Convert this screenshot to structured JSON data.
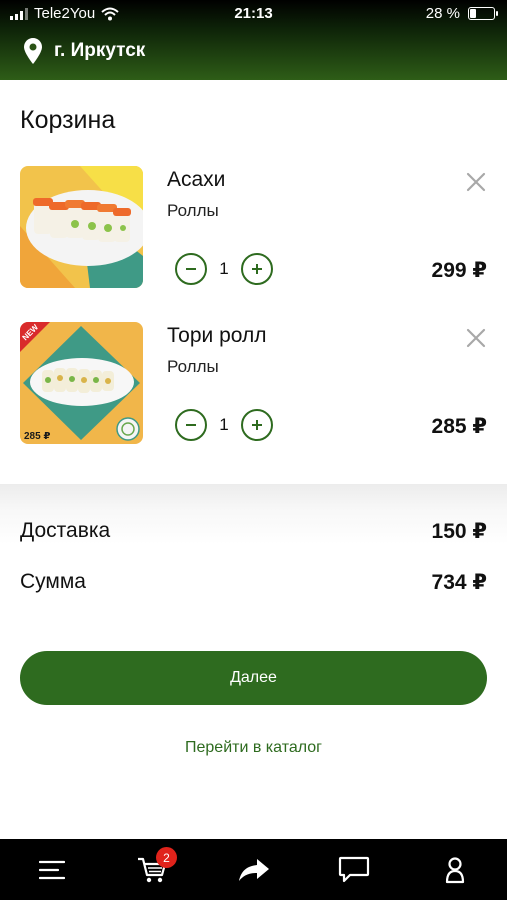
{
  "status_bar": {
    "carrier": "Tele2You",
    "time": "21:13",
    "battery_percent": "28 %",
    "battery_level": 0.28
  },
  "header": {
    "city": "г. Иркутск",
    "icon": "location-pin-icon"
  },
  "cart": {
    "title": "Корзина",
    "items": [
      {
        "name": "Асахи",
        "category": "Роллы",
        "quantity": "1",
        "price": "299 ₽"
      },
      {
        "name": "Тори ролл",
        "category": "Роллы",
        "quantity": "1",
        "price": "285 ₽",
        "image_badge": "NEW",
        "image_price": "285 ₽"
      }
    ]
  },
  "summary": {
    "delivery_label": "Доставка",
    "delivery_value": "150 ₽",
    "total_label": "Сумма",
    "total_value": "734 ₽"
  },
  "actions": {
    "next_label": "Далее",
    "catalog_link": "Перейти в каталог"
  },
  "tab_bar": {
    "cart_badge": "2",
    "icons": [
      "menu-icon",
      "cart-icon",
      "share-icon",
      "chat-icon",
      "profile-icon"
    ]
  },
  "colors": {
    "accent": "#2e6b1f",
    "header_gradient_end": "#2e5d17",
    "badge": "#e0231b"
  }
}
